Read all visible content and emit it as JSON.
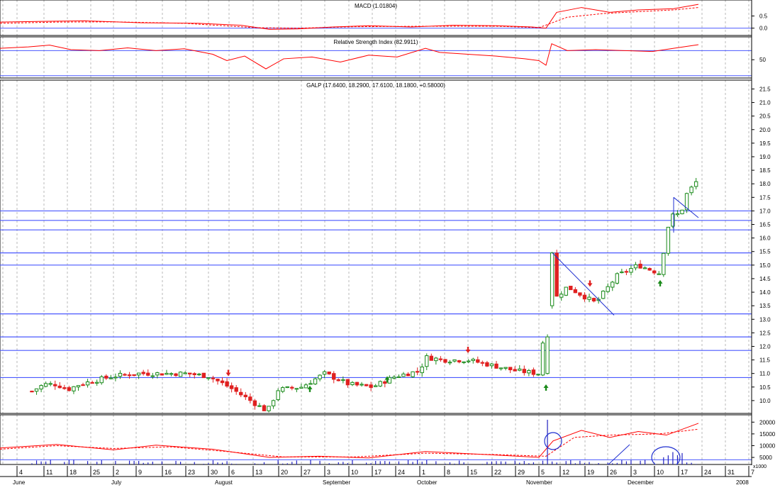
{
  "panels": {
    "macd": {
      "title": "MACD (1.01804)",
      "ticks": [
        "0.5",
        "0.0"
      ],
      "ylim": [
        -0.3,
        1.1
      ]
    },
    "rsi": {
      "title": "Relative Strength Index (82.9911)",
      "ticks": [
        "50"
      ],
      "ylim": [
        10,
        100
      ]
    },
    "price": {
      "title": "GALP (17.6400, 18.2900, 17.6100, 18.1800, +0.58000)",
      "ticks": [
        "21.5",
        "21.0",
        "20.5",
        "20.0",
        "19.5",
        "19.0",
        "18.5",
        "18.0",
        "17.5",
        "17.0",
        "16.5",
        "16.0",
        "15.5",
        "15.0",
        "14.5",
        "14.0",
        "13.5",
        "13.0",
        "12.5",
        "12.0",
        "11.5",
        "11.0",
        "10.5",
        "10.0"
      ],
      "ylim": [
        9.5,
        21.8
      ]
    },
    "volume": {
      "ticks": [
        "20000",
        "15000",
        "10000",
        "5000"
      ],
      "unit": "x1000",
      "ylim": [
        2000,
        22500
      ]
    }
  },
  "xaxis": {
    "day_labels": [
      "4",
      "11",
      "18",
      "25",
      "2",
      "9",
      "16",
      "23",
      "30",
      "6",
      "13",
      "20",
      "27",
      "3",
      "10",
      "17",
      "24",
      "1",
      "8",
      "15",
      "22",
      "29",
      "5",
      "12",
      "19",
      "26",
      "3",
      "10",
      "17",
      "24",
      "31",
      "7"
    ],
    "month_labels": [
      "June",
      "July",
      "August",
      "September",
      "October",
      "November",
      "December",
      "2008"
    ]
  },
  "chart_data": {
    "type": "candlestick",
    "title": "GALP (17.6400, 18.2900, 17.6100, 18.1800, +0.58000)",
    "last_bar": {
      "open": 17.64,
      "high": 18.29,
      "low": 17.61,
      "close": 18.18,
      "change": 0.58
    },
    "price_anchors": [
      {
        "week": "Jun 4",
        "close": 10.3
      },
      {
        "week": "Jun 11",
        "close": 10.6
      },
      {
        "week": "Jun 18",
        "close": 10.6
      },
      {
        "week": "Jun 25",
        "close": 10.4
      },
      {
        "week": "Jul 2",
        "close": 10.6
      },
      {
        "week": "Jul 9",
        "close": 10.9
      },
      {
        "week": "Jul 16",
        "close": 11.0
      },
      {
        "week": "Jul 23",
        "close": 11.0
      },
      {
        "week": "Jul 30",
        "close": 11.0
      },
      {
        "week": "Aug 6",
        "close": 10.9
      },
      {
        "week": "Aug 13",
        "close": 10.5
      },
      {
        "week": "Aug 16",
        "close": 9.6
      },
      {
        "week": "Aug 20",
        "close": 10.4
      },
      {
        "week": "Aug 27",
        "close": 10.5
      },
      {
        "week": "Sep 3",
        "close": 11.0
      },
      {
        "week": "Sep 10",
        "close": 10.6
      },
      {
        "week": "Sep 17",
        "close": 10.5
      },
      {
        "week": "Sep 24",
        "close": 10.9
      },
      {
        "week": "Oct 1",
        "close": 11.1
      },
      {
        "week": "Oct 3",
        "close": 11.6
      },
      {
        "week": "Oct 8",
        "close": 11.5
      },
      {
        "week": "Oct 15",
        "close": 11.5
      },
      {
        "week": "Oct 22",
        "close": 11.3
      },
      {
        "week": "Oct 29",
        "close": 11.1
      },
      {
        "week": "Nov 5",
        "close": 11.0
      },
      {
        "week": "Nov 7",
        "close": 13.5
      },
      {
        "week": "Nov 12",
        "close": 14.2
      },
      {
        "week": "Nov 19",
        "close": 13.6
      },
      {
        "week": "Nov 26",
        "close": 14.6
      },
      {
        "week": "Dec 3",
        "close": 15.0
      },
      {
        "week": "Dec 10",
        "close": 14.7
      },
      {
        "week": "Dec 14",
        "close": 16.8
      },
      {
        "week": "Dec 19",
        "close": 16.9
      },
      {
        "week": "Dec 21",
        "close": 17.6
      },
      {
        "week": "Dec 24",
        "close": 18.18
      }
    ],
    "horizontal_lines": [
      17.0,
      16.65,
      16.3,
      15.45,
      15.0,
      13.2,
      12.35,
      11.85,
      10.85
    ],
    "colors": {
      "up": "#1a8a1a",
      "down": "#e02020",
      "line": "#ff0000",
      "guide": "#4a58ff",
      "annotation": "#2030d0"
    },
    "grid": "vertical dashed",
    "xlabel": "",
    "ylabel": ""
  }
}
